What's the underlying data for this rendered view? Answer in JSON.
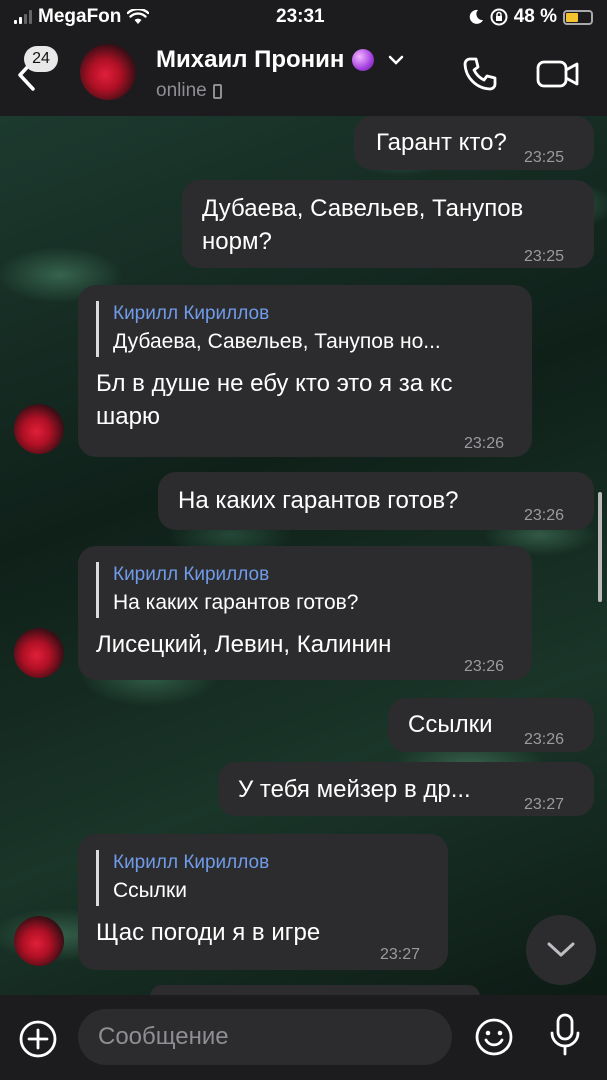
{
  "status_bar": {
    "carrier": "MegaFon",
    "time": "23:31",
    "battery": "48 %"
  },
  "header": {
    "unread_count": "24",
    "contact_name": "Михаил Пронин",
    "contact_status": "online"
  },
  "messages": [
    {
      "text": "Гарант кто?",
      "time": "23:25"
    },
    {
      "text": "Дубаева, Савельев, Танупов\nнорм?",
      "time": "23:25"
    },
    {
      "reply_name": "Кирилл Кириллов",
      "reply_text": "Дубаева, Савельев, Танупов но...",
      "text": "Бл в душе не ебу кто это я за кс\nшарю",
      "time": "23:26"
    },
    {
      "text": "На каких гарантов готов?",
      "time": "23:26"
    },
    {
      "reply_name": "Кирилл Кириллов",
      "reply_text": "На каких гарантов готов?",
      "text": "Лисецкий, Левин, Калинин",
      "time": "23:26"
    },
    {
      "text": "Ссылки",
      "time": "23:26"
    },
    {
      "text": "У тебя мейзер в др...",
      "time": "23:27"
    },
    {
      "reply_name": "Кирилл Кириллов",
      "reply_text": "Ссылки",
      "text": "Щас погоди я в игре",
      "time": "23:27"
    }
  ],
  "composer": {
    "placeholder": "Сообщение"
  },
  "icons": {
    "back": "chevron-left-icon",
    "call": "phone-icon",
    "video": "video-camera-icon",
    "add": "plus-circle-icon",
    "emoji": "smiley-icon",
    "mic": "microphone-icon",
    "scroll": "chevron-down-icon"
  },
  "colors": {
    "accent_reply_name": "#6f9be8",
    "bubble": "#2c2c2e",
    "battery": "#f4c430"
  }
}
